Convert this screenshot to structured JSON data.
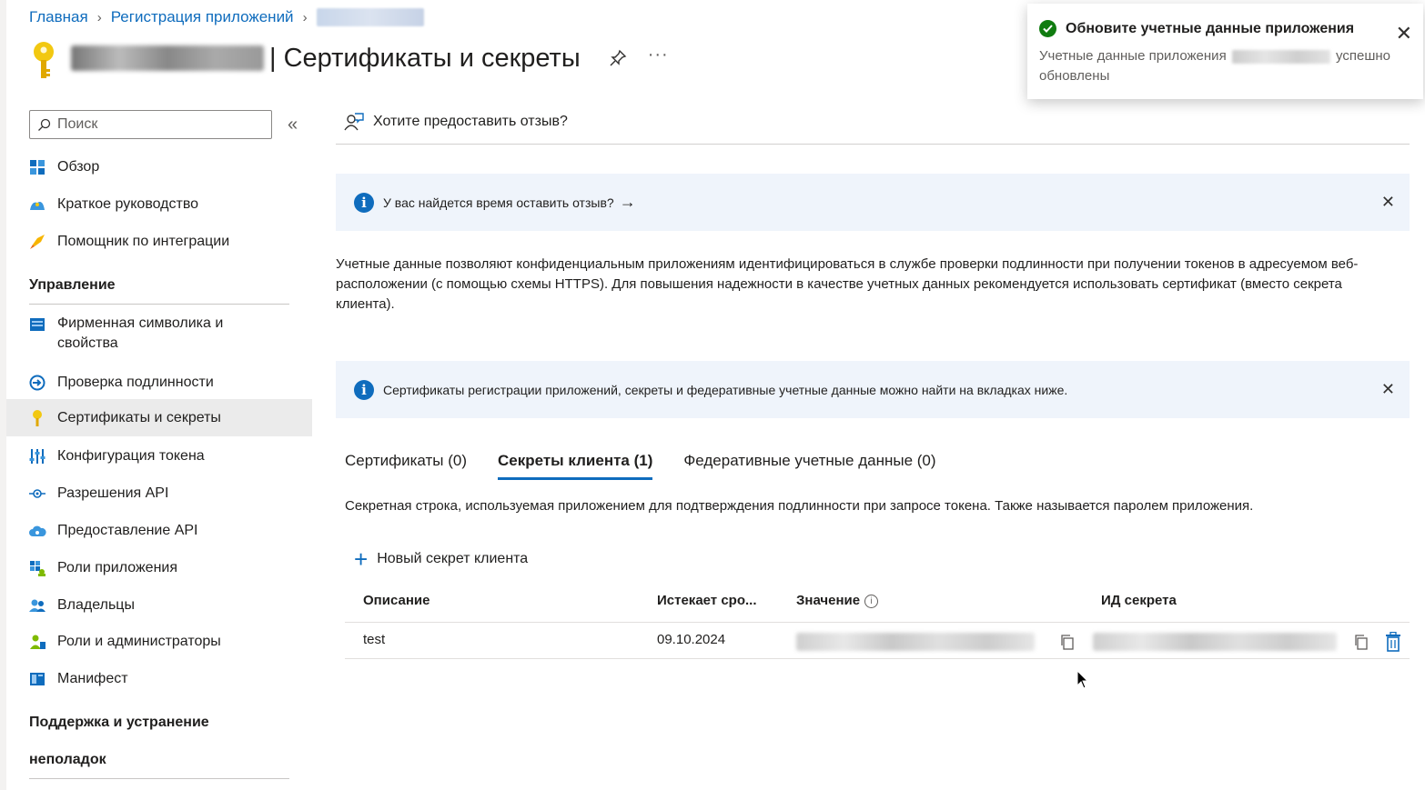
{
  "breadcrumb": {
    "home": "Главная",
    "app_registrations": "Регистрация приложений"
  },
  "header": {
    "title": "| Сертификаты и секреты",
    "more": "···"
  },
  "sidebar": {
    "search_placeholder": "Поиск",
    "collapse": "«",
    "items_top": [
      {
        "label": "Обзор",
        "icon": "overview-icon"
      },
      {
        "label": "Краткое руководство",
        "icon": "quickstart-icon"
      },
      {
        "label": "Помощник по интеграции",
        "icon": "rocket-icon"
      }
    ],
    "section_manage": "Управление",
    "items_manage": [
      {
        "label": "Фирменная символика и свойства",
        "icon": "branding-icon"
      },
      {
        "label": "Проверка подлинности",
        "icon": "auth-icon"
      },
      {
        "label": "Сертификаты и секреты",
        "icon": "key-icon"
      },
      {
        "label": "Конфигурация токена",
        "icon": "token-config-icon"
      },
      {
        "label": "Разрешения API",
        "icon": "api-permissions-icon"
      },
      {
        "label": "Предоставление API",
        "icon": "cloud-icon"
      },
      {
        "label": "Роли приложения",
        "icon": "app-roles-icon"
      },
      {
        "label": "Владельцы",
        "icon": "owners-icon"
      },
      {
        "label": "Роли и администраторы",
        "icon": "admin-roles-icon"
      },
      {
        "label": "Манифест",
        "icon": "manifest-icon"
      }
    ],
    "section_support_line1": "Поддержка и устранение",
    "section_support_line2": "неполадок"
  },
  "main": {
    "feedback_link": "Хотите предоставить отзыв?",
    "banner1": "У вас найдется время оставить отзыв?",
    "banner1_arrow": "→",
    "description": "Учетные данные позволяют конфиденциальным приложениям идентифицироваться в службе проверки подлинности при получении токенов в адресуемом веб-расположении (с помощью схемы HTTPS). Для повышения надежности в качестве учетных данных рекомендуется использовать сертификат (вместо секрета клиента).",
    "banner2": "Сертификаты регистрации приложений, секреты и федеративные учетные данные можно найти на вкладках ниже.",
    "tabs": [
      {
        "label": "Сертификаты (0)"
      },
      {
        "label": "Секреты клиента (1)"
      },
      {
        "label": "Федеративные учетные данные (0)"
      }
    ],
    "tab_description": "Секретная строка, используемая приложением для подтверждения подлинности при запросе токена. Также называется паролем приложения.",
    "new_secret": "Новый секрет клиента",
    "table": {
      "headers": [
        "Описание",
        "Истекает сро...",
        "Значение",
        "ИД секрета"
      ],
      "rows": [
        {
          "description": "test",
          "expires": "09.10.2024"
        }
      ]
    }
  },
  "toast": {
    "title": "Обновите учетные данные приложения",
    "body_start": "Учетные данные приложения",
    "body_end": "успешно обновлены"
  },
  "colors": {
    "accent": "#0f6cbd",
    "success": "#107c10",
    "banner_bg": "#eff4fb",
    "key_yellow": "#f2c811"
  }
}
